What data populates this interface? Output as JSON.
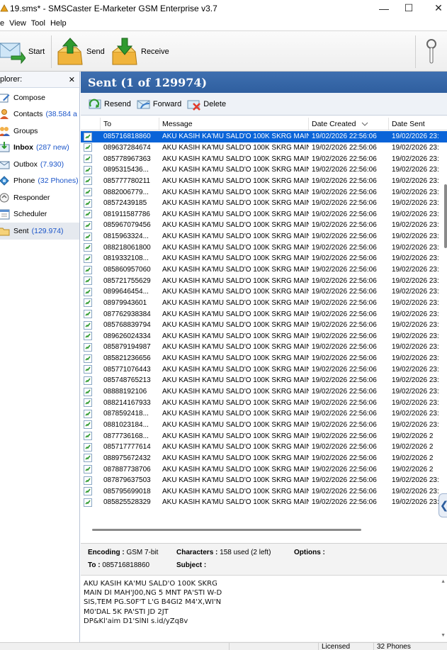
{
  "window": {
    "title": "19.sms* - SMSCaster E-Marketer GSM Enterprise v3.7",
    "minimize_glyph": "—",
    "maximize_glyph": "☐",
    "close_glyph": "✕"
  },
  "menu": [
    "e",
    "View",
    "Tool",
    "Help"
  ],
  "toolbar": {
    "start_label": "Start",
    "send_label": "Send",
    "receive_label": "Receive"
  },
  "explorer": {
    "title": "plorer:",
    "close_glyph": "✕",
    "items": [
      {
        "label": "Compose",
        "count": "",
        "icon": "compose-icon",
        "bold": false
      },
      {
        "label": "Contacts",
        "count": "(38.584 a",
        "icon": "contacts-icon",
        "bold": false
      },
      {
        "label": "Groups",
        "count": "",
        "icon": "groups-icon",
        "bold": false
      },
      {
        "label": "Inbox",
        "count": "(287 new)",
        "icon": "inbox-icon",
        "bold": true
      },
      {
        "label": "Outbox",
        "count": "(7.930)",
        "icon": "outbox-icon",
        "bold": false
      },
      {
        "label": "Phone",
        "count": "(32 Phones)",
        "icon": "phone-icon",
        "bold": false
      },
      {
        "label": "Responder",
        "count": "",
        "icon": "responder-icon",
        "bold": false
      },
      {
        "label": "Scheduler",
        "count": "",
        "icon": "scheduler-icon",
        "bold": false
      },
      {
        "label": "Sent",
        "count": "(129.974)",
        "icon": "sent-folder-icon",
        "bold": false
      }
    ]
  },
  "sent": {
    "header": "Sent (1 of 129974)",
    "actions": {
      "resend": "Resend",
      "forward": "Forward",
      "delete": "Delete"
    },
    "columns": {
      "to": "To",
      "message": "Message",
      "date_created": "Date Created",
      "date_sent": "Date Sent"
    },
    "rows": [
      {
        "to": "085716818860",
        "message": "AKU KASIH KA'MU SALD'O 100K SKRG MAIN ...",
        "created": "19/02/2026 22:56:06",
        "sent": "19/02/2026 23:"
      },
      {
        "to": "089637284674",
        "message": "AKU KASIH KA'MU SALD'O 100K SKRG MAIN ...",
        "created": "19/02/2026 22:56:06",
        "sent": "19/02/2026 23:"
      },
      {
        "to": "085778967363",
        "message": "AKU KASIH KA'MU SALD'O 100K SKRG MAIN ...",
        "created": "19/02/2026 22:56:06",
        "sent": "19/02/2026 23:"
      },
      {
        "to": "0895315436...",
        "message": "AKU KASIH KA'MU SALD'O 100K SKRG MAIN ...",
        "created": "19/02/2026 22:56:06",
        "sent": "19/02/2026 23:"
      },
      {
        "to": "085777780211",
        "message": "AKU KASIH KA'MU SALD'O 100K SKRG MAIN ...",
        "created": "19/02/2026 22:56:06",
        "sent": "19/02/2026 23:"
      },
      {
        "to": "0882006779...",
        "message": "AKU KASIH KA'MU SALD'O 100K SKRG MAIN ...",
        "created": "19/02/2026 22:56:06",
        "sent": "19/02/2026 23:"
      },
      {
        "to": "08572439185",
        "message": "AKU KASIH KA'MU SALD'O 100K SKRG MAIN ...",
        "created": "19/02/2026 22:56:06",
        "sent": "19/02/2026 23:"
      },
      {
        "to": "081911587786",
        "message": "AKU KASIH KA'MU SALD'O 100K SKRG MAIN ...",
        "created": "19/02/2026 22:56:06",
        "sent": "19/02/2026 23:"
      },
      {
        "to": "085967079456",
        "message": "AKU KASIH KA'MU SALD'O 100K SKRG MAIN ...",
        "created": "19/02/2026 22:56:06",
        "sent": "19/02/2026 23:"
      },
      {
        "to": "0815963324...",
        "message": "AKU KASIH KA'MU SALD'O 100K SKRG MAIN ...",
        "created": "19/02/2026 22:56:06",
        "sent": "19/02/2026 23:"
      },
      {
        "to": "088218061800",
        "message": "AKU KASIH KA'MU SALD'O 100K SKRG MAIN ...",
        "created": "19/02/2026 22:56:06",
        "sent": "19/02/2026 23:"
      },
      {
        "to": "0819332108...",
        "message": "AKU KASIH KA'MU SALD'O 100K SKRG MAIN ...",
        "created": "19/02/2026 22:56:06",
        "sent": "19/02/2026 23:"
      },
      {
        "to": "085860957060",
        "message": "AKU KASIH KA'MU SALD'O 100K SKRG MAIN ...",
        "created": "19/02/2026 22:56:06",
        "sent": "19/02/2026 23:"
      },
      {
        "to": "085721755629",
        "message": "AKU KASIH KA'MU SALD'O 100K SKRG MAIN ...",
        "created": "19/02/2026 22:56:06",
        "sent": "19/02/2026 23:"
      },
      {
        "to": "0899646454...",
        "message": "AKU KASIH KA'MU SALD'O 100K SKRG MAIN ...",
        "created": "19/02/2026 22:56:06",
        "sent": "19/02/2026 23:"
      },
      {
        "to": "08979943601",
        "message": "AKU KASIH KA'MU SALD'O 100K SKRG MAIN ...",
        "created": "19/02/2026 22:56:06",
        "sent": "19/02/2026 23:"
      },
      {
        "to": "087762938384",
        "message": "AKU KASIH KA'MU SALD'O 100K SKRG MAIN ...",
        "created": "19/02/2026 22:56:06",
        "sent": "19/02/2026 23:"
      },
      {
        "to": "085768839794",
        "message": "AKU KASIH KA'MU SALD'O 100K SKRG MAIN ...",
        "created": "19/02/2026 22:56:06",
        "sent": "19/02/2026 23:"
      },
      {
        "to": "089626024334",
        "message": "AKU KASIH KA'MU SALD'O 100K SKRG MAIN ...",
        "created": "19/02/2026 22:56:06",
        "sent": "19/02/2026 23:"
      },
      {
        "to": "085879194987",
        "message": "AKU KASIH KA'MU SALD'O 100K SKRG MAIN ...",
        "created": "19/02/2026 22:56:06",
        "sent": "19/02/2026 23:"
      },
      {
        "to": "085821236656",
        "message": "AKU KASIH KA'MU SALD'O 100K SKRG MAIN ...",
        "created": "19/02/2026 22:56:06",
        "sent": "19/02/2026 23:"
      },
      {
        "to": "085771076443",
        "message": "AKU KASIH KA'MU SALD'O 100K SKRG MAIN ...",
        "created": "19/02/2026 22:56:06",
        "sent": "19/02/2026 23:"
      },
      {
        "to": "085748765213",
        "message": "AKU KASIH KA'MU SALD'O 100K SKRG MAIN ...",
        "created": "19/02/2026 22:56:06",
        "sent": "19/02/2026 23:"
      },
      {
        "to": "08888192106",
        "message": "AKU KASIH KA'MU SALD'O 100K SKRG MAIN ...",
        "created": "19/02/2026 22:56:06",
        "sent": "19/02/2026 23:"
      },
      {
        "to": "088214167933",
        "message": "AKU KASIH KA'MU SALD'O 100K SKRG MAIN ...",
        "created": "19/02/2026 22:56:06",
        "sent": "19/02/2026 23:"
      },
      {
        "to": "0878592418...",
        "message": "AKU KASIH KA'MU SALD'O 100K SKRG MAIN ...",
        "created": "19/02/2026 22:56:06",
        "sent": "19/02/2026 23:"
      },
      {
        "to": "0881023184...",
        "message": "AKU KASIH KA'MU SALD'O 100K SKRG MAIN ...",
        "created": "19/02/2026 22:56:06",
        "sent": "19/02/2026 23:"
      },
      {
        "to": "0877736168...",
        "message": "AKU KASIH KA'MU SALD'O 100K SKRG MAIN ...",
        "created": "19/02/2026 22:56:06",
        "sent": "19/02/2026 2"
      },
      {
        "to": "085717777614",
        "message": "AKU KASIH KA'MU SALD'O 100K SKRG MAIN ...",
        "created": "19/02/2026 22:56:06",
        "sent": "19/02/2026 2"
      },
      {
        "to": "088975672432",
        "message": "AKU KASIH KA'MU SALD'O 100K SKRG MAIN ...",
        "created": "19/02/2026 22:56:06",
        "sent": "19/02/2026 2"
      },
      {
        "to": "087887738706",
        "message": "AKU KASIH KA'MU SALD'O 100K SKRG MAIN ...",
        "created": "19/02/2026 22:56:06",
        "sent": "19/02/2026 2"
      },
      {
        "to": "087879637503",
        "message": "AKU KASIH KA'MU SALD'O 100K SKRG MAIN ...",
        "created": "19/02/2026 22:56:06",
        "sent": "19/02/2026 23:"
      },
      {
        "to": "085795699018",
        "message": "AKU KASIH KA'MU SALD'O 100K SKRG MAIN ...",
        "created": "19/02/2026 22:56:06",
        "sent": "19/02/2026 23:"
      },
      {
        "to": "085825528329",
        "message": "AKU KASIH KA'MU SALD'O 100K SKRG MAIN ...",
        "created": "19/02/2026 22:56:06",
        "sent": "19/02/2026 23:"
      }
    ],
    "side_arrow_glyph": "❮"
  },
  "detail": {
    "encoding_label": "Encoding :",
    "encoding_value": "GSM 7-bit",
    "characters_label": "Characters :",
    "characters_value": "158 used (2 left)",
    "options_label": "Options :",
    "to_label": "To :",
    "to_value": "085716818860",
    "subject_label": "Subject :",
    "message": "AKU KASIH KA'MU SALD'O 100K SKRG\nMAIN DI MAH'J00,NG 5 MNT PA'STI W-D\nSIS,TEM PG.S0F'T L'G B4GI2 M4'X,WI'N\nM0'DAL 5K PA'STI JD 2JT\nDP&Kl'aim D1'SlNI s.id/yZq8v"
  },
  "status": {
    "licensed": "Licensed",
    "phones": "32 Phones"
  },
  "colors": {
    "header_blue": "#2f5f9f",
    "selection_blue": "#0a64d8",
    "link_blue": "#1b55c9"
  }
}
